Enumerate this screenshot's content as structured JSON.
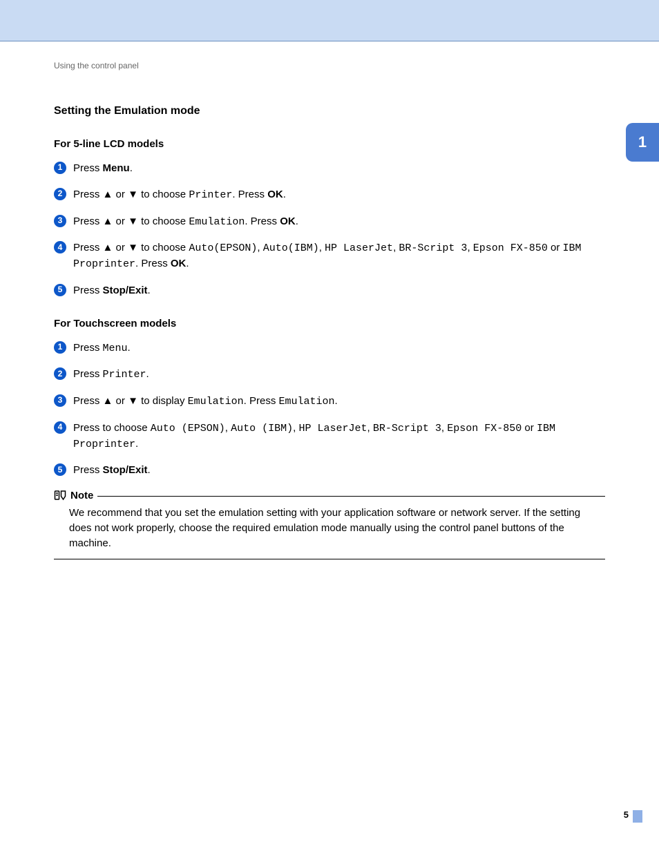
{
  "header": {
    "breadcrumb": "Using the control panel"
  },
  "chapter_tab": "1",
  "page_number": "5",
  "section": {
    "title": "Setting the Emulation mode",
    "groups": [
      {
        "heading": "For 5-line LCD models",
        "steps": [
          {
            "num": "1",
            "parts": [
              {
                "t": "Press "
              },
              {
                "t": "Menu",
                "bold": true
              },
              {
                "t": "."
              }
            ]
          },
          {
            "num": "2",
            "parts": [
              {
                "t": "Press "
              },
              {
                "t": "▲",
                "cls": "arrow"
              },
              {
                "t": " or "
              },
              {
                "t": "▼",
                "cls": "arrow"
              },
              {
                "t": " to choose "
              },
              {
                "t": "Printer",
                "mono": true
              },
              {
                "t": ". Press "
              },
              {
                "t": "OK",
                "bold": true
              },
              {
                "t": "."
              }
            ]
          },
          {
            "num": "3",
            "parts": [
              {
                "t": "Press "
              },
              {
                "t": "▲",
                "cls": "arrow"
              },
              {
                "t": " or "
              },
              {
                "t": "▼",
                "cls": "arrow"
              },
              {
                "t": " to choose "
              },
              {
                "t": "Emulation",
                "mono": true
              },
              {
                "t": ". Press "
              },
              {
                "t": "OK",
                "bold": true
              },
              {
                "t": "."
              }
            ]
          },
          {
            "num": "4",
            "parts": [
              {
                "t": "Press "
              },
              {
                "t": "▲",
                "cls": "arrow"
              },
              {
                "t": " or "
              },
              {
                "t": "▼",
                "cls": "arrow"
              },
              {
                "t": " to choose "
              },
              {
                "t": "Auto(EPSON)",
                "mono": true
              },
              {
                "t": ", "
              },
              {
                "t": "Auto(IBM)",
                "mono": true
              },
              {
                "t": ", "
              },
              {
                "t": "HP LaserJet",
                "mono": true
              },
              {
                "t": ", "
              },
              {
                "t": "BR-Script 3",
                "mono": true
              },
              {
                "t": ", "
              },
              {
                "t": "Epson FX-850",
                "mono": true
              },
              {
                "t": " or "
              },
              {
                "t": "IBM Proprinter",
                "mono": true
              },
              {
                "t": ". Press "
              },
              {
                "t": "OK",
                "bold": true
              },
              {
                "t": "."
              }
            ]
          },
          {
            "num": "5",
            "parts": [
              {
                "t": "Press "
              },
              {
                "t": "Stop/Exit",
                "bold": true
              },
              {
                "t": "."
              }
            ]
          }
        ]
      },
      {
        "heading": "For Touchscreen models",
        "steps": [
          {
            "num": "1",
            "parts": [
              {
                "t": "Press "
              },
              {
                "t": "Menu",
                "mono": true
              },
              {
                "t": "."
              }
            ]
          },
          {
            "num": "2",
            "parts": [
              {
                "t": "Press "
              },
              {
                "t": "Printer",
                "mono": true
              },
              {
                "t": "."
              }
            ]
          },
          {
            "num": "3",
            "parts": [
              {
                "t": "Press "
              },
              {
                "t": "▲",
                "cls": "arrow"
              },
              {
                "t": " or "
              },
              {
                "t": "▼",
                "cls": "arrow"
              },
              {
                "t": " to display "
              },
              {
                "t": "Emulation",
                "mono": true
              },
              {
                "t": ". Press "
              },
              {
                "t": "Emulation",
                "mono": true
              },
              {
                "t": "."
              }
            ]
          },
          {
            "num": "4",
            "parts": [
              {
                "t": "Press to choose "
              },
              {
                "t": "Auto (EPSON)",
                "mono": true
              },
              {
                "t": ", "
              },
              {
                "t": "Auto (IBM)",
                "mono": true
              },
              {
                "t": ", "
              },
              {
                "t": "HP LaserJet",
                "mono": true
              },
              {
                "t": ", "
              },
              {
                "t": "BR-Script 3",
                "mono": true
              },
              {
                "t": ", "
              },
              {
                "t": "Epson FX-850",
                "mono": true
              },
              {
                "t": " or "
              },
              {
                "t": "IBM Proprinter",
                "mono": true
              },
              {
                "t": "."
              }
            ]
          },
          {
            "num": "5",
            "parts": [
              {
                "t": "Press "
              },
              {
                "t": "Stop/Exit",
                "bold": true
              },
              {
                "t": "."
              }
            ]
          }
        ]
      }
    ],
    "note": {
      "label": "Note",
      "body": "We recommend that you set the emulation setting with your application software or network server. If the setting does not work properly, choose the required emulation mode manually using the control panel buttons of the machine."
    }
  }
}
